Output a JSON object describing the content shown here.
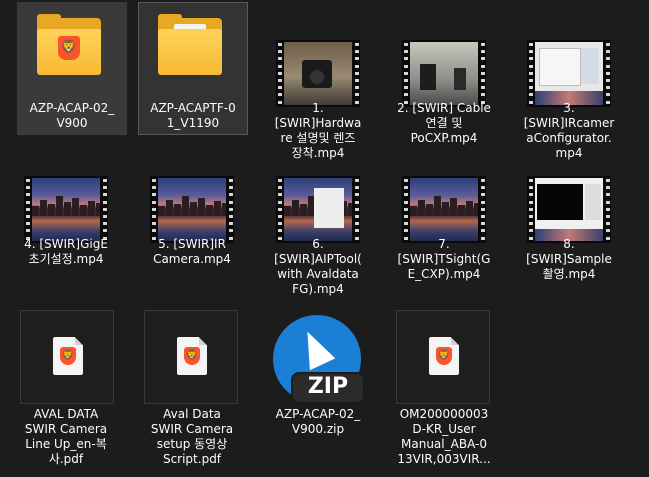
{
  "items": [
    {
      "id": "f1",
      "name": "AZP-ACAP-02_\nV900",
      "type": "folder"
    },
    {
      "id": "f2",
      "name": "AZP-ACAPTF-0\n1_V1190",
      "type": "folder"
    },
    {
      "id": "v1",
      "name": "1.\n[SWIR]Hardwa\nre 설명및 렌즈\n장착.mp4",
      "type": "video"
    },
    {
      "id": "v2",
      "name": "2. [SWIR] Cable\n연결 및\nPoCXP.mp4",
      "type": "video"
    },
    {
      "id": "v3",
      "name": "3.\n[SWIR]IRcamer\naConfigurator.\nmp4",
      "type": "video"
    },
    {
      "id": "v4",
      "name": "4. [SWIR]GigE\n초기설정.mp4",
      "type": "video"
    },
    {
      "id": "v5",
      "name": "5. [SWIR]IR\nCamera.mp4",
      "type": "video"
    },
    {
      "id": "v6",
      "name": "6.\n[SWIR]AIPTool(\nwith Avaldata\nFG).mp4",
      "type": "video"
    },
    {
      "id": "v7",
      "name": "7.\n[SWIR]TSight(G\nE_CXP).mp4",
      "type": "video"
    },
    {
      "id": "v8",
      "name": "8.\n[SWIR]Sample\n촬영.mp4",
      "type": "video"
    },
    {
      "id": "p1",
      "name": "AVAL DATA\nSWIR Camera\nLine Up_en-복\n사.pdf",
      "type": "pdf"
    },
    {
      "id": "p2",
      "name": "Aval Data\nSWIR Camera\nsetup 동영상\nScript.pdf",
      "type": "pdf"
    },
    {
      "id": "z1",
      "name": "AZP-ACAP-02_\nV900.zip",
      "type": "zip",
      "badge": "ZIP"
    },
    {
      "id": "p3",
      "name": "OM200000003\nD-KR_User\nManual_ABA-0\n13VIR,003VIR...",
      "type": "pdf"
    }
  ],
  "colors": {
    "folder": "#f7b933",
    "zip_blue": "#1c7fd6",
    "pdf_brand": "#fb542b",
    "background": "#1c1c1c"
  },
  "icons": {
    "folder": "folder-icon",
    "video": "video-thumbnail-icon",
    "pdf": "pdf-file-icon",
    "zip": "zip-archive-icon"
  }
}
